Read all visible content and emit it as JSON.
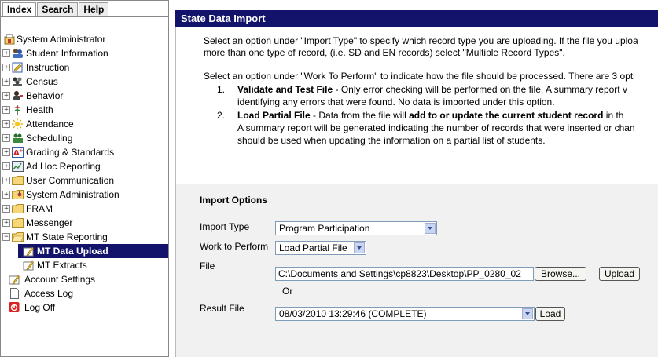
{
  "nav": {
    "tabs": [
      "Index",
      "Search",
      "Help"
    ],
    "items": [
      {
        "label": "System Administrator",
        "icon": "portal-icon"
      },
      {
        "label": "Student Information",
        "icon": "students-icon"
      },
      {
        "label": "Instruction",
        "icon": "instruction-icon"
      },
      {
        "label": "Census",
        "icon": "census-icon"
      },
      {
        "label": "Behavior",
        "icon": "behavior-icon"
      },
      {
        "label": "Health",
        "icon": "health-icon"
      },
      {
        "label": "Attendance",
        "icon": "attendance-icon"
      },
      {
        "label": "Scheduling",
        "icon": "scheduling-icon"
      },
      {
        "label": "Grading & Standards",
        "icon": "grading-icon"
      },
      {
        "label": "Ad Hoc Reporting",
        "icon": "reporting-icon"
      },
      {
        "label": "User Communication",
        "icon": "folder-icon"
      },
      {
        "label": "System Administration",
        "icon": "admin-folder-icon"
      },
      {
        "label": "FRAM",
        "icon": "folder-icon"
      },
      {
        "label": "Messenger",
        "icon": "folder-icon"
      },
      {
        "label": "MT State Reporting",
        "icon": "folder-open-icon"
      },
      {
        "label": "MT Data Upload",
        "icon": "tool-icon"
      },
      {
        "label": "MT Extracts",
        "icon": "tool-icon"
      },
      {
        "label": "Account Settings",
        "icon": "settings-icon"
      },
      {
        "label": "Access Log",
        "icon": "document-icon"
      },
      {
        "label": "Log Off",
        "icon": "power-icon"
      }
    ]
  },
  "main": {
    "title": "State Data Import",
    "intro1_line1": "Select an option under \"Import Type\" to specify which record type you are uploading. If the file you uploa",
    "intro1_line2": "more than one type of record, (i.e. SD and EN records) select \"Multiple Record Types\".",
    "intro2": "Select an option under \"Work To Perform\" to indicate how the file should be processed. There are 3 opti",
    "option1": {
      "num": "1.",
      "title": "Validate and Test File",
      "text": " - Only error checking will be performed on the file. A summary report v",
      "line2": "identifying any errors that were found. No data is imported under this option."
    },
    "option2": {
      "num": "2.",
      "title": "Load Partial File",
      "text_a": " - Data from the file will ",
      "bold": "add to or update the current student record",
      "text_b": " in th",
      "line2": "A summary report will be generated indicating the number of records that were inserted or chan",
      "line3": "should be used when updating the information on a partial list of students."
    }
  },
  "import_options": {
    "heading": "Import Options",
    "import_type_label": "Import Type",
    "import_type_value": "Program Participation",
    "work_label": "Work to Perform",
    "work_value": "Load Partial File",
    "file_label": "File",
    "file_value": "C:\\Documents and Settings\\cp8823\\Desktop\\PP_0280_02",
    "browse_label": "Browse...",
    "upload_label": "Upload",
    "or_label": "Or",
    "result_label": "Result File",
    "result_value": "08/03/2010 13:29:46 (COMPLETE)",
    "load_label": "Load"
  }
}
